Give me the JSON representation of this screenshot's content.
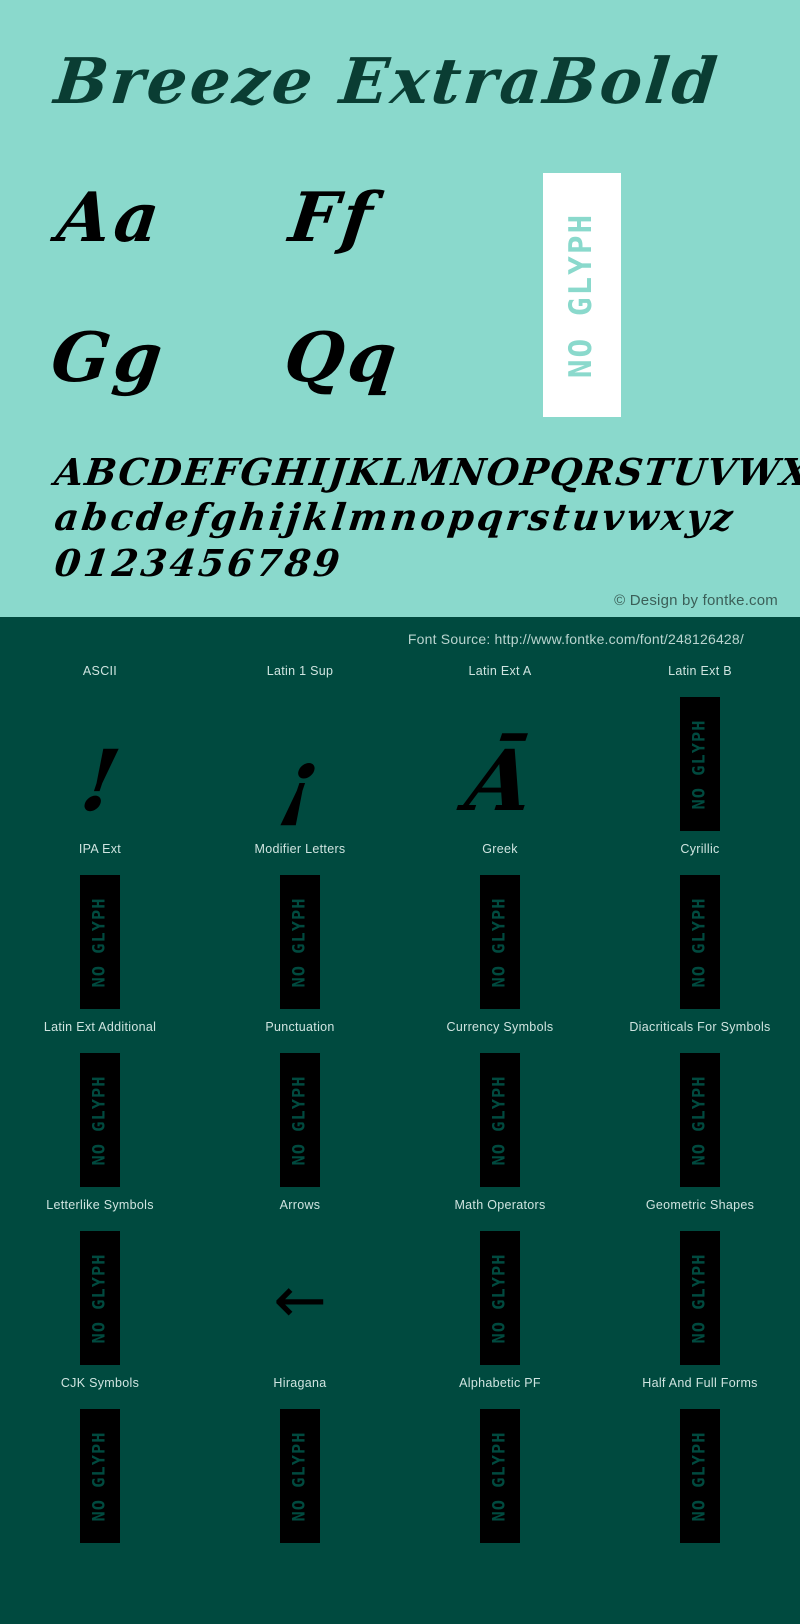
{
  "theme": {
    "hero_bg": "#8ad9cc",
    "panel_bg": "#004a3f",
    "glyph_color": "#000000",
    "label_color": "#cfe4e0",
    "noglyph_box_bg": "#ffffff"
  },
  "hero": {
    "title": "Breeze ExtraBold",
    "letter_pairs": [
      "Aa",
      "Ff",
      "Gg",
      "Qq"
    ],
    "noglyph_label": "NO GLYPH",
    "alphabet_upper": "ABCDEFGHIJKLMNOPQRSTUVWXYZ",
    "alphabet_lower": "abcdefghijklmnopqrstuvwxyz",
    "digits": "0123456789",
    "credit": "© Design by fontke.com"
  },
  "panel": {
    "source": "Font Source: http://www.fontke.com/font/248126428/",
    "blocks": [
      {
        "label": "ASCII",
        "glyph": "!",
        "has_glyph": true
      },
      {
        "label": "Latin 1 Sup",
        "glyph": "¡",
        "has_glyph": true
      },
      {
        "label": "Latin Ext A",
        "glyph": "Ā",
        "has_glyph": true
      },
      {
        "label": "Latin Ext B",
        "glyph": "",
        "has_glyph": false
      },
      {
        "label": "IPA Ext",
        "glyph": "",
        "has_glyph": false
      },
      {
        "label": "Modifier Letters",
        "glyph": "",
        "has_glyph": false
      },
      {
        "label": "Greek",
        "glyph": "",
        "has_glyph": false
      },
      {
        "label": "Cyrillic",
        "glyph": "",
        "has_glyph": false
      },
      {
        "label": "Latin Ext Additional",
        "glyph": "",
        "has_glyph": false
      },
      {
        "label": "Punctuation",
        "glyph": "",
        "has_glyph": false
      },
      {
        "label": "Currency Symbols",
        "glyph": "",
        "has_glyph": false
      },
      {
        "label": "Diacriticals For Symbols",
        "glyph": "",
        "has_glyph": false
      },
      {
        "label": "Letterlike Symbols",
        "glyph": "",
        "has_glyph": false
      },
      {
        "label": "Arrows",
        "glyph": "←",
        "has_glyph": true
      },
      {
        "label": "Math Operators",
        "glyph": "",
        "has_glyph": false
      },
      {
        "label": "Geometric Shapes",
        "glyph": "",
        "has_glyph": false
      },
      {
        "label": "CJK Symbols",
        "glyph": "",
        "has_glyph": false
      },
      {
        "label": "Hiragana",
        "glyph": "",
        "has_glyph": false
      },
      {
        "label": "Alphabetic PF",
        "glyph": "",
        "has_glyph": false
      },
      {
        "label": "Half And Full Forms",
        "glyph": "",
        "has_glyph": false
      }
    ]
  }
}
